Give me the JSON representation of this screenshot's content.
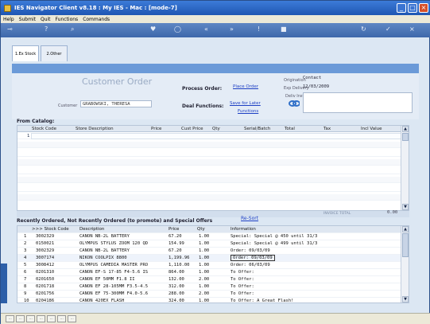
{
  "window": {
    "title": "IES Navigator Client v8.18 : My IES - Mac :    [mode-7]"
  },
  "menu": [
    "Help",
    "Submit",
    "Quit",
    "Functions",
    "Commands"
  ],
  "tabs": [
    {
      "label": "1.Ex Stock"
    },
    {
      "label": "2.Other"
    }
  ],
  "form": {
    "title": "Customer Order",
    "customer_label": "Customer",
    "customer_value": "GRABOWSKI, THERESA",
    "process_order_label": "Process Order:",
    "place_order_link": "Place Order",
    "deal_functions_label": "Deal Functions:",
    "save_later_link": "Save for Later",
    "functions_link": "Functions",
    "origination_label": "Origination",
    "origination_value": "Contact",
    "exp_delivery_label": "Exp Delivery",
    "exp_delivery_value": "12/03/2009",
    "deliv_instr_label": "Deliv Instr"
  },
  "catalog": {
    "label": "From Catalog:",
    "headers": [
      "Stock Code",
      "Store Description",
      "Price",
      "Cust Price",
      "Qty",
      "Serial/Batch",
      "Total",
      "Tax",
      "Incl Value"
    ],
    "first_row": "1",
    "invoice_total_label": "INVOICE TOTAL",
    "invoice_total_value": "0.00"
  },
  "recent": {
    "label": "Recently Ordered, Not Recently Ordered (to promote) and Special Offers",
    "resort_link": "Re-Sort",
    "headers": [
      ">>> Stock Code",
      "Description",
      "Price",
      "Qty",
      "Information"
    ],
    "rows": [
      {
        "n": "1",
        "code": "3002329",
        "desc": "CANON NB-2L BATTERY",
        "price": "67.20",
        "qty": "1.00",
        "info": "Special: Special @ 450 until 31/3"
      },
      {
        "n": "2",
        "code": "0150021",
        "desc": "OLYMPUS STYLUS ZOOM 120 QD",
        "price": "154.99",
        "qty": "1.00",
        "info": "Special: Special @ 499 until 31/3"
      },
      {
        "n": "3",
        "code": "3002329",
        "desc": "CANON NB-2L BATTERY",
        "price": "67.20",
        "qty": "1.00",
        "info": "Order: 09/03/09"
      },
      {
        "n": "4",
        "code": "3007174",
        "desc": "NIKON COOLPIX 8800",
        "price": "1,199.96",
        "qty": "1.00",
        "info": "Order: 09/03/09"
      },
      {
        "n": "5",
        "code": "3008412",
        "desc": "OLYMPUS CAMEDIA MASTER PRO",
        "price": "1,110.00",
        "qty": "1.00",
        "info": "Order: 06/03/09"
      },
      {
        "n": "6",
        "code": "0201310",
        "desc": "CANON EF-S 17-85 F4-5.6 IS",
        "price": "864.00",
        "qty": "1.00",
        "info": "To Offer:"
      },
      {
        "n": "7",
        "code": "0201650",
        "desc": "CANON EF 50MM F1.8 II",
        "price": "132.00",
        "qty": "2.00",
        "info": "To Offer:"
      },
      {
        "n": "8",
        "code": "0201718",
        "desc": "CANON EF 28-105MM F3.5-4.5",
        "price": "312.00",
        "qty": "1.00",
        "info": "To Offer:"
      },
      {
        "n": "9",
        "code": "0201756",
        "desc": "CANON EF 75-300MM F4.0-5.6",
        "price": "288.00",
        "qty": "2.00",
        "info": "To Offer:"
      },
      {
        "n": "10",
        "code": "0204186",
        "desc": "CANON 420EX FLASH",
        "price": "324.00",
        "qty": "1.00",
        "info": "To Offer: A Great Flash!"
      }
    ]
  }
}
